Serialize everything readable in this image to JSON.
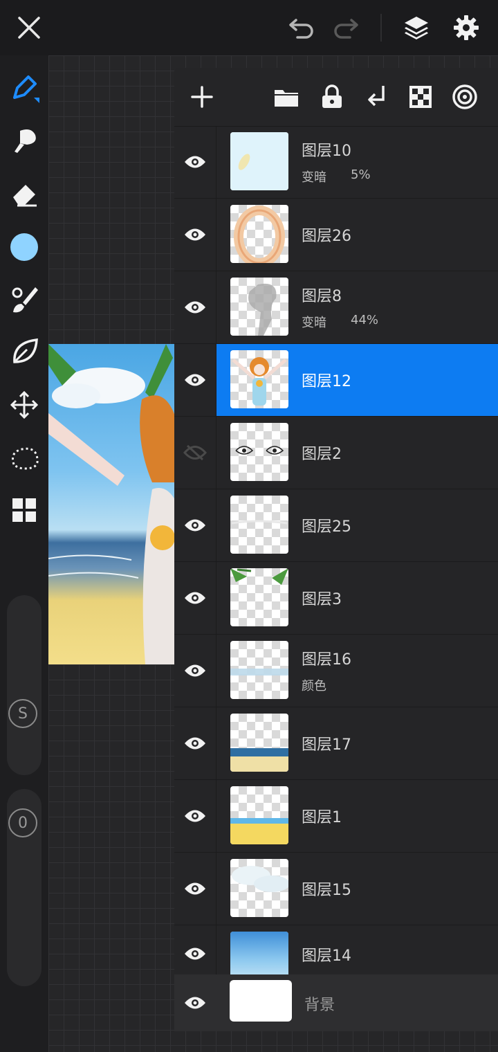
{
  "top_bar": {
    "close_icon": "close-icon",
    "undo_icon": "undo-icon",
    "redo_icon": "redo-icon",
    "layers_icon": "layers-icon",
    "settings_icon": "gear-icon"
  },
  "tools": [
    {
      "name": "pen-icon"
    },
    {
      "name": "smudge-icon"
    },
    {
      "name": "eraser-icon"
    },
    {
      "name": "color-swatch",
      "color": "#8fd3ff"
    },
    {
      "name": "brush-icon"
    },
    {
      "name": "leaf-icon"
    },
    {
      "name": "move-icon"
    },
    {
      "name": "lasso-icon"
    },
    {
      "name": "grid-icon"
    }
  ],
  "sliders": {
    "size_label": "S",
    "opacity_label": "0"
  },
  "panel_toolbar": [
    "add-layer-icon",
    "folder-icon",
    "lock-icon",
    "merge-down-icon",
    "transparency-icon",
    "reference-icon"
  ],
  "layers": [
    {
      "name": "图层10",
      "blend": "变暗",
      "opacity": "5%",
      "visible": true,
      "selected": false,
      "thumb": "light-blue"
    },
    {
      "name": "图层26",
      "blend": "",
      "opacity": "",
      "visible": true,
      "selected": false,
      "thumb": "ring"
    },
    {
      "name": "图层8",
      "blend": "变暗",
      "opacity": "44%",
      "visible": true,
      "selected": false,
      "thumb": "shadow"
    },
    {
      "name": "图层12",
      "blend": "",
      "opacity": "",
      "visible": true,
      "selected": true,
      "thumb": "character"
    },
    {
      "name": "图层2",
      "blend": "",
      "opacity": "",
      "visible": false,
      "selected": false,
      "thumb": "eyes"
    },
    {
      "name": "图层25",
      "blend": "",
      "opacity": "",
      "visible": true,
      "selected": false,
      "thumb": "line"
    },
    {
      "name": "图层3",
      "blend": "",
      "opacity": "",
      "visible": true,
      "selected": false,
      "thumb": "palms"
    },
    {
      "name": "图层16",
      "blend": "颜色",
      "opacity": "",
      "visible": true,
      "selected": false,
      "thumb": "water-line"
    },
    {
      "name": "图层17",
      "blend": "",
      "opacity": "",
      "visible": true,
      "selected": false,
      "thumb": "beach"
    },
    {
      "name": "图层1",
      "blend": "",
      "opacity": "",
      "visible": true,
      "selected": false,
      "thumb": "sand"
    },
    {
      "name": "图层15",
      "blend": "",
      "opacity": "",
      "visible": true,
      "selected": false,
      "thumb": "clouds"
    },
    {
      "name": "图层14",
      "blend": "",
      "opacity": "",
      "visible": true,
      "selected": false,
      "thumb": "sky"
    }
  ],
  "background_layer": {
    "name": "背景",
    "visible": true
  },
  "colors": {
    "accent": "#0d7cf2",
    "panel": "#252527",
    "swatch": "#8fd3ff"
  }
}
